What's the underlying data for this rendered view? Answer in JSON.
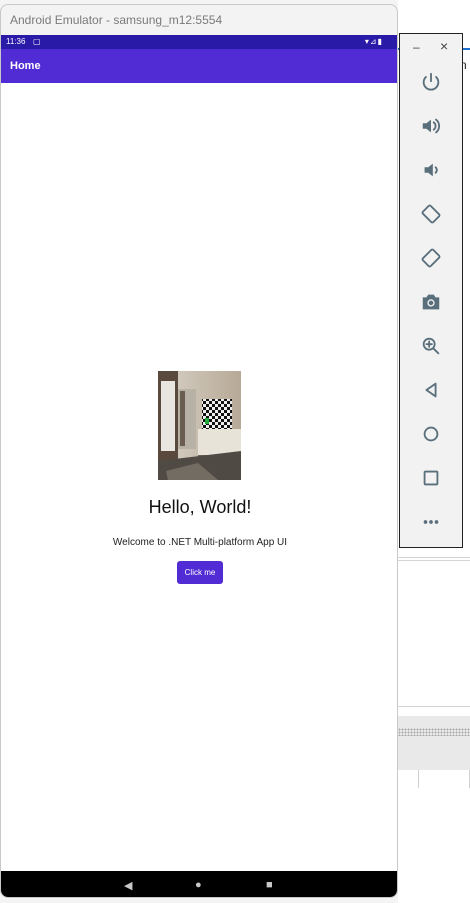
{
  "window": {
    "title": "Android Emulator - samsung_m12:5554"
  },
  "status_bar": {
    "time": "11:36",
    "sim_icon": "sim-card-icon",
    "right_icons": "▾⊿▮"
  },
  "app_bar": {
    "title": "Home"
  },
  "content": {
    "image": "bedroom-photo",
    "heading": "Hello, World!",
    "subtitle": "Welcome to .NET Multi-platform App UI",
    "button_label": "Click me"
  },
  "nav_bar": {
    "back": "◀",
    "home": "●",
    "recents": "■"
  },
  "toolbar": {
    "minimize": "–",
    "close": "×",
    "tools": [
      "power",
      "volume-up",
      "volume-down",
      "rotate-left",
      "rotate-right",
      "screenshot",
      "zoom",
      "back",
      "home",
      "overview",
      "more"
    ]
  },
  "background_ide": {
    "tab_fragment": "n"
  },
  "colors": {
    "accent": "#512bd4",
    "status_bar": "#2a1aa8"
  }
}
